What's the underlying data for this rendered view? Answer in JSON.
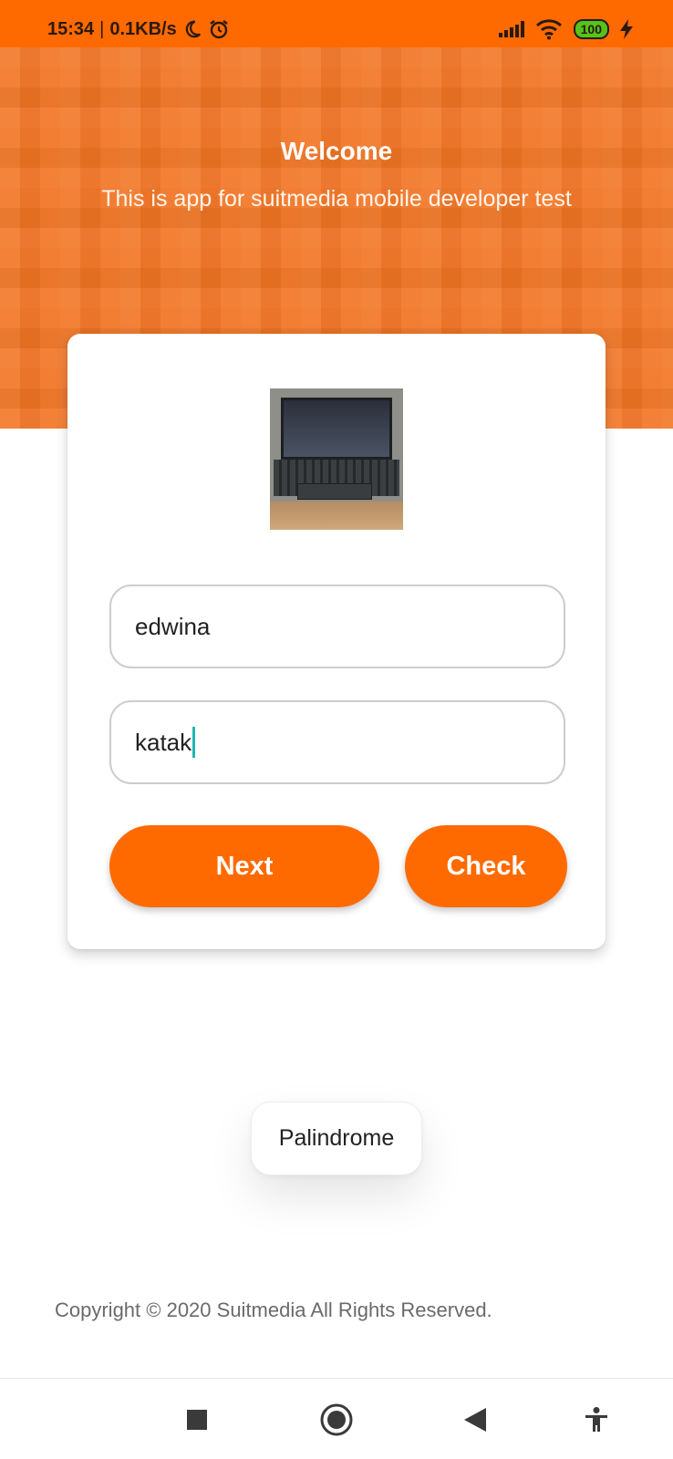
{
  "status_bar": {
    "time": "15:34",
    "separator": "|",
    "speed": "0.1KB/s",
    "icons": [
      "moon-icon",
      "alarm-icon",
      "signal-icon",
      "wifi-icon",
      "battery-icon",
      "charging-icon"
    ],
    "battery": "100"
  },
  "header": {
    "title": "Welcome",
    "subtitle": "This is app for suitmedia mobile developer test"
  },
  "form": {
    "name_value": "edwina",
    "word_value": "katak"
  },
  "buttons": {
    "next_label": "Next",
    "check_label": "Check"
  },
  "result_chip": "Palindrome",
  "footer": {
    "copyright": "Copyright © 2020 Suitmedia All Rights Reserved."
  },
  "navigation": {
    "icons": [
      "recents-icon",
      "home-icon",
      "back-icon",
      "accessibility-icon"
    ]
  },
  "colors": {
    "accent": "#ff6a00",
    "hero": "#f27524",
    "caret": "#1fb7b0",
    "battery": "#54c41a"
  }
}
